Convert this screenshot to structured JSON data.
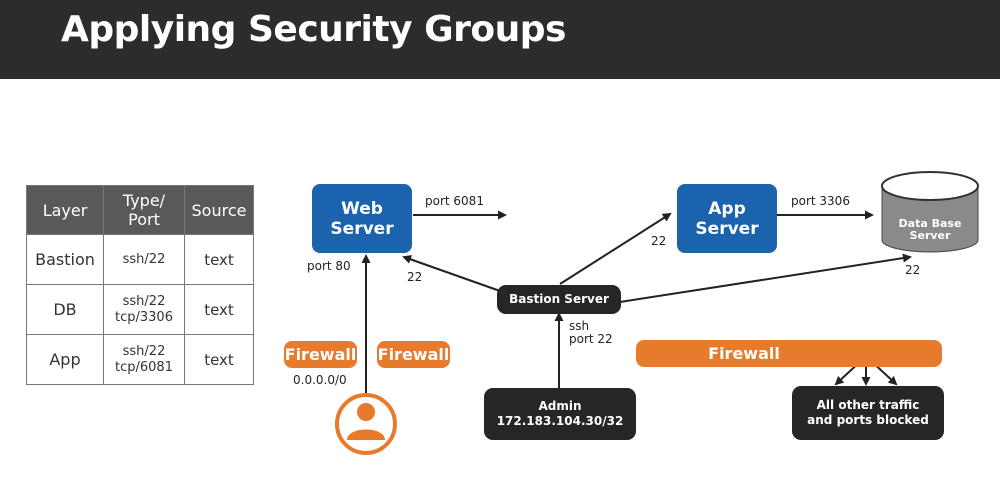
{
  "title": "Applying Security Groups",
  "table": {
    "headers": [
      "Layer",
      "Type/\nPort",
      "Source"
    ],
    "rows": [
      {
        "layer": "Bastion",
        "type_port": "ssh/22",
        "source": "text"
      },
      {
        "layer": "DB",
        "type_port": "ssh/22\ntcp/3306",
        "source": "text"
      },
      {
        "layer": "App",
        "type_port": "ssh/22\ntcp/6081",
        "source": "text"
      }
    ]
  },
  "nodes": {
    "web_server": "Web\nServer",
    "app_server": "App\nServer",
    "db_server": "Data Base\nServer",
    "bastion": "Bastion Server",
    "admin": "Admin\n172.183.104.30/32",
    "blocked": "All other traffic\nand ports blocked",
    "firewall_1": "Firewall",
    "firewall_2": "Firewall",
    "firewall_3": "Firewall"
  },
  "labels": {
    "port_6081": "port 6081",
    "port_3306": "port 3306",
    "port_80": "port 80",
    "web_22": "22",
    "app_22": "22",
    "db_22": "22",
    "ssh": "ssh",
    "port_22": "port 22",
    "any_ip": "0.0.0.0/0"
  },
  "colors": {
    "header_bg": "#2c2c2c",
    "server_blue": "#1c63ad",
    "firewall_orange": "#e87a2c",
    "dark_box": "#262626",
    "db_gray": "#8a8a8a"
  },
  "icons": [
    "user-icon",
    "blocked-x-icon",
    "database-cylinder-icon"
  ]
}
